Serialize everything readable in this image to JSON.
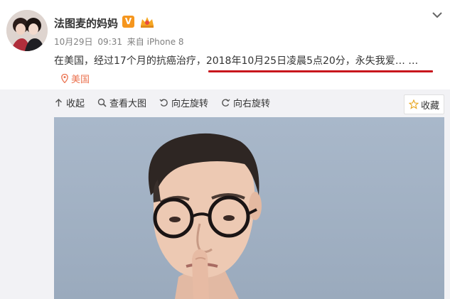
{
  "user": {
    "name": "法图麦的妈妈",
    "badge": "V"
  },
  "meta": {
    "date": "10月29日",
    "time": "09:31",
    "source": "来自 iPhone 8"
  },
  "post": {
    "text_part1": "在美国，经过17个月的抗癌治疗，",
    "text_part2": "2018年10月25日凌晨5点20分，永失我爱",
    "text_ellipsis": "… …",
    "location": "美国"
  },
  "toolbar": {
    "collapse": "收起",
    "view_large": "查看大图",
    "rotate_left": "向左旋转",
    "rotate_right": "向右旋转",
    "favorite": "收藏"
  },
  "colors": {
    "location": "#eb7350",
    "underline": "#c8151d",
    "badge": "#f5961e"
  }
}
